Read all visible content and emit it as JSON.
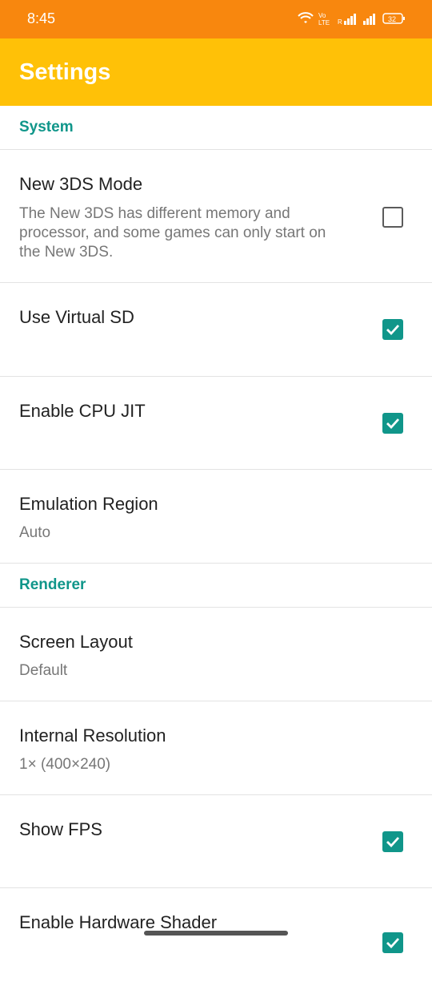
{
  "status_bar": {
    "time": "8:45",
    "battery": "32"
  },
  "app_bar": {
    "title": "Settings"
  },
  "sections": {
    "system": "System",
    "renderer": "Renderer"
  },
  "items": {
    "new3ds": {
      "title": "New 3DS Mode",
      "summary": "The New 3DS has different memory and processor, and some games can only start on the New 3DS.",
      "checked": false
    },
    "virtual_sd": {
      "title": "Use Virtual SD",
      "checked": true
    },
    "cpu_jit": {
      "title": "Enable CPU JIT",
      "checked": true
    },
    "region": {
      "title": "Emulation Region",
      "value": "Auto"
    },
    "screen_layout": {
      "title": "Screen Layout",
      "value": "Default"
    },
    "resolution": {
      "title": "Internal Resolution",
      "value": "1× (400×240)"
    },
    "show_fps": {
      "title": "Show FPS",
      "checked": true
    },
    "hw_shader": {
      "title": "Enable Hardware Shader",
      "checked": true
    }
  },
  "colors": {
    "status_bar": "#f8870e",
    "app_bar": "#ffc107",
    "accent": "#10968a"
  }
}
